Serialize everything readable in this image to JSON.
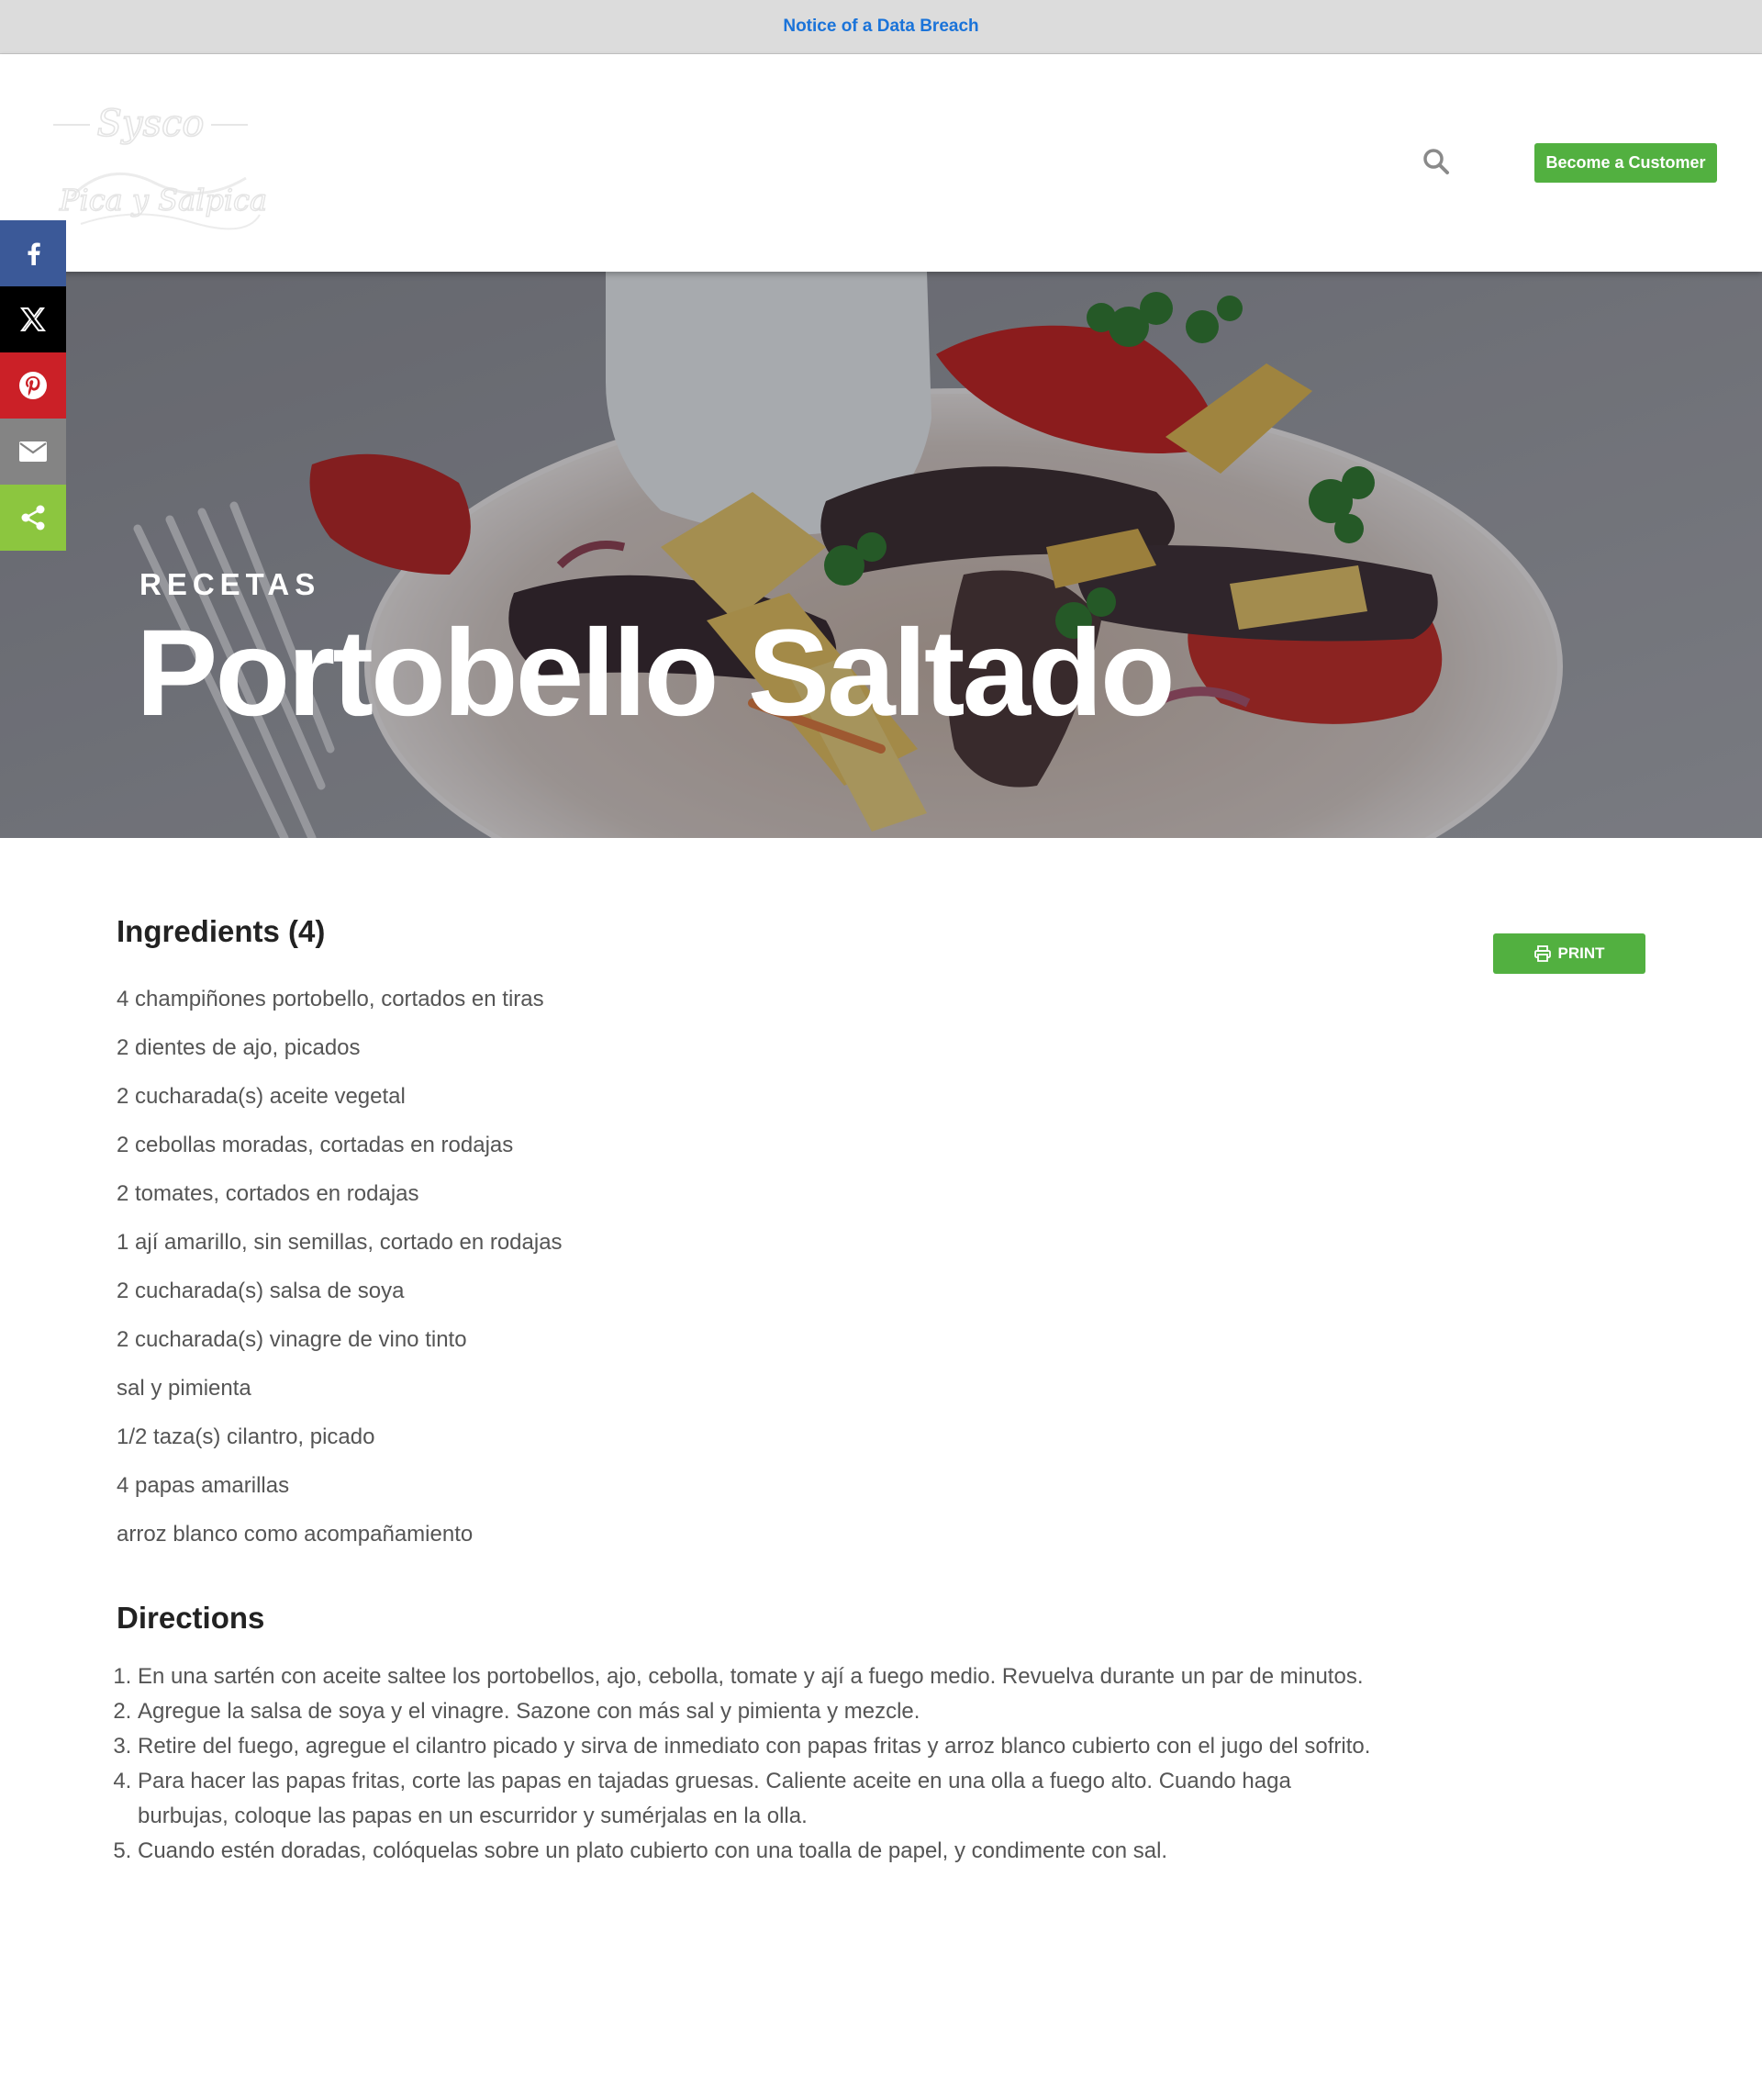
{
  "notice": {
    "text": "Notice of a Data Breach"
  },
  "header": {
    "logo_text_top": "Sysco",
    "logo_text_bottom": "Pica y Salpica",
    "search_icon": "search-icon",
    "customer_button": "Become a Customer"
  },
  "share": {
    "items": [
      {
        "name": "facebook",
        "icon": "facebook-icon",
        "color": "#3b5998"
      },
      {
        "name": "x",
        "icon": "x-twitter-icon",
        "color": "#000000"
      },
      {
        "name": "pinterest",
        "icon": "pinterest-icon",
        "color": "#cb2027"
      },
      {
        "name": "email",
        "icon": "email-icon",
        "color": "#848484"
      },
      {
        "name": "share",
        "icon": "share-icon",
        "color": "#8cc63f"
      }
    ]
  },
  "hero": {
    "eyebrow": "RECETAS",
    "title": "Portobello Saltado"
  },
  "recipe": {
    "ingredients_title": "Ingredients (4)",
    "print_label": "PRINT",
    "ingredients": [
      "4 champiñones portobello, cortados en tiras",
      "2 dientes de ajo, picados",
      "2 cucharada(s) aceite vegetal",
      "2 cebollas moradas, cortadas en rodajas",
      "2 tomates, cortados en rodajas",
      "1 ají amarillo, sin semillas, cortado en rodajas",
      "2 cucharada(s) salsa de soya",
      "2 cucharada(s) vinagre de vino tinto",
      "sal y pimienta",
      "1/2 taza(s) cilantro, picado",
      "4 papas amarillas",
      "arroz blanco como acompañamiento"
    ],
    "directions_title": "Directions",
    "directions": [
      "En una sartén con aceite saltee los portobellos, ajo, cebolla, tomate y ají a fuego medio. Revuelva durante un par de minutos.",
      "Agregue la salsa de soya y el vinagre. Sazone con más sal y pimienta y mezcle.",
      "Retire del fuego, agregue el cilantro picado y sirva de inmediato con papas fritas y arroz blanco cubierto con el jugo del sofrito.",
      "Para hacer las papas fritas, corte las papas en tajadas gruesas. Caliente aceite en una olla a fuego alto. Cuando haga burbujas, coloque las papas en un escurridor y sumérjalas en la olla.",
      "Cuando estén doradas, colóquelas sobre un plato cubierto con una toalla de papel, y condimente con sal."
    ]
  },
  "colors": {
    "accent_green": "#52b040",
    "notice_link": "#1a73d9"
  }
}
